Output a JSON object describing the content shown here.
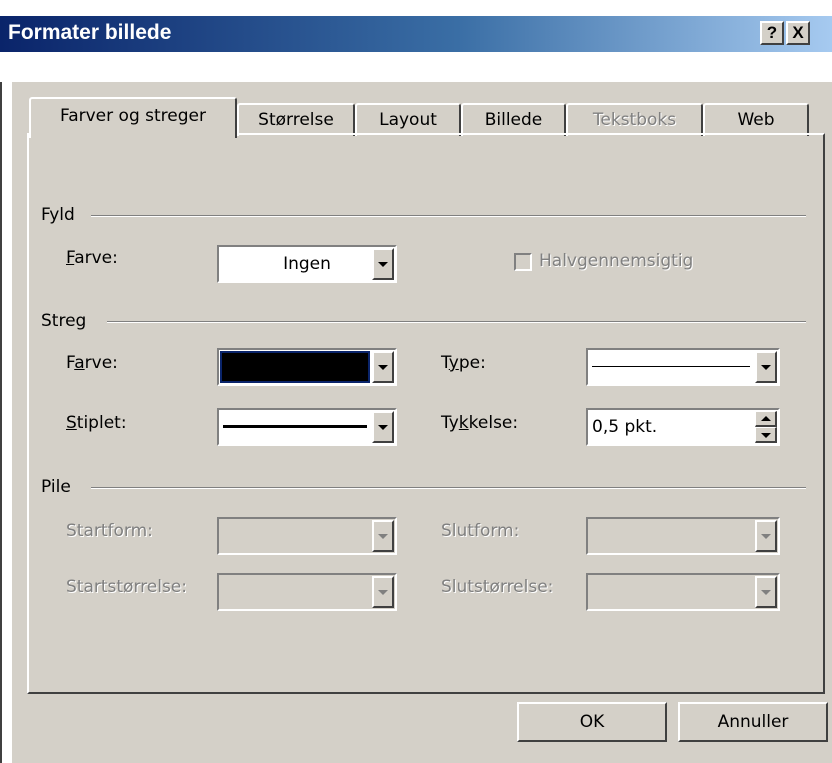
{
  "window": {
    "title": "Formater billede",
    "help_button": "?",
    "close_button": "X"
  },
  "tabs": [
    {
      "label": "Farver og streger",
      "active": true,
      "enabled": true
    },
    {
      "label": "Størrelse",
      "active": false,
      "enabled": true
    },
    {
      "label": "Layout",
      "active": false,
      "enabled": true
    },
    {
      "label": "Billede",
      "active": false,
      "enabled": true
    },
    {
      "label": "Tekstboks",
      "active": false,
      "enabled": false
    },
    {
      "label": "Web",
      "active": false,
      "enabled": true
    }
  ],
  "fill": {
    "group_label": "Fyld",
    "color_label_mnemonic": "F",
    "color_label_rest": "arve:",
    "color_value": "Ingen",
    "semi_transparent_label": "Halvgennemsigtig",
    "semi_transparent_checked": false,
    "semi_transparent_enabled": false
  },
  "line": {
    "group_label": "Streg",
    "color_label_pre": "F",
    "color_label_mnemonic": "a",
    "color_label_post": "rve:",
    "color_value": "#000000",
    "type_label_pre": "T",
    "type_label_mnemonic": "y",
    "type_label_post": "pe:",
    "type_value": "solid-line",
    "dash_label_mnemonic": "S",
    "dash_label_rest": "tiplet:",
    "dash_value": "solid-line",
    "weight_label_pre": "Ty",
    "weight_label_mnemonic": "k",
    "weight_label_post": "kelse:",
    "weight_value": "0,5 pkt."
  },
  "arrows": {
    "group_label": "Pile",
    "begin_style_label": "Startform:",
    "end_style_label": "Slutform:",
    "begin_size_label": "Startstørrelse:",
    "end_size_label": "Slutstørrelse:",
    "enabled": false
  },
  "buttons": {
    "ok": "OK",
    "cancel": "Annuller"
  },
  "colors": {
    "face": "#d4d0c8",
    "title_start": "#0a246a",
    "title_end": "#a6caf0",
    "disabled_text": "#808080"
  }
}
